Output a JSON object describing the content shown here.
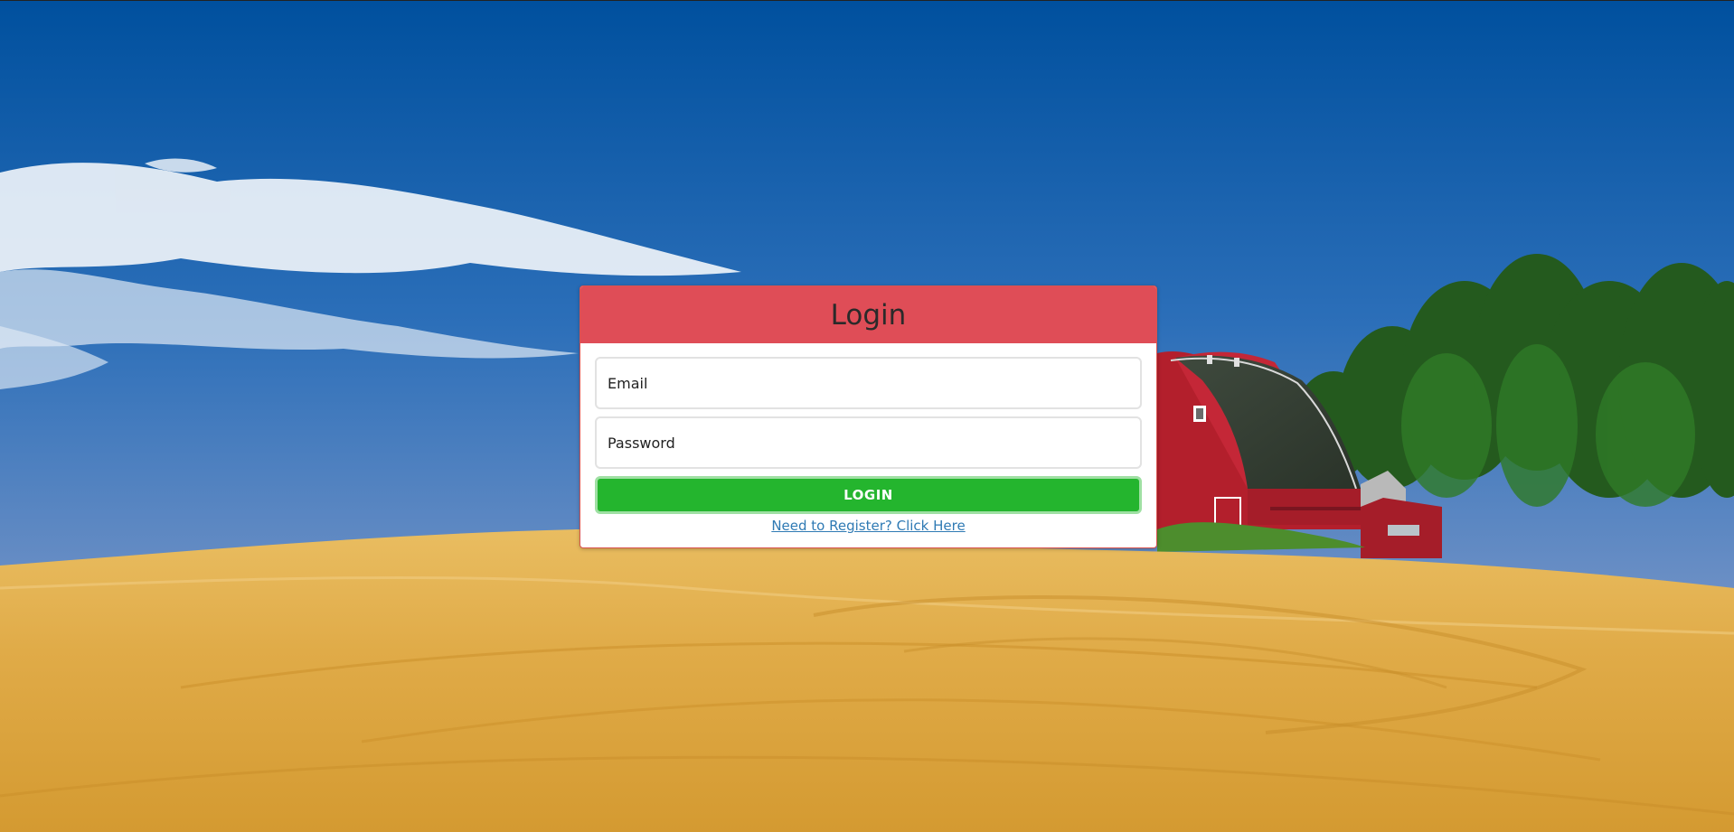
{
  "login": {
    "title": "Login",
    "email_placeholder": "Email",
    "password_placeholder": "Password",
    "button_label": "LOGIN",
    "register_link": "Need to Register? Click Here"
  },
  "colors": {
    "header": "#df4d57",
    "button": "#24b52e",
    "link": "#2f7ab4",
    "sky_top": "#0a57a3",
    "field_wheat": "#e0ac48"
  }
}
